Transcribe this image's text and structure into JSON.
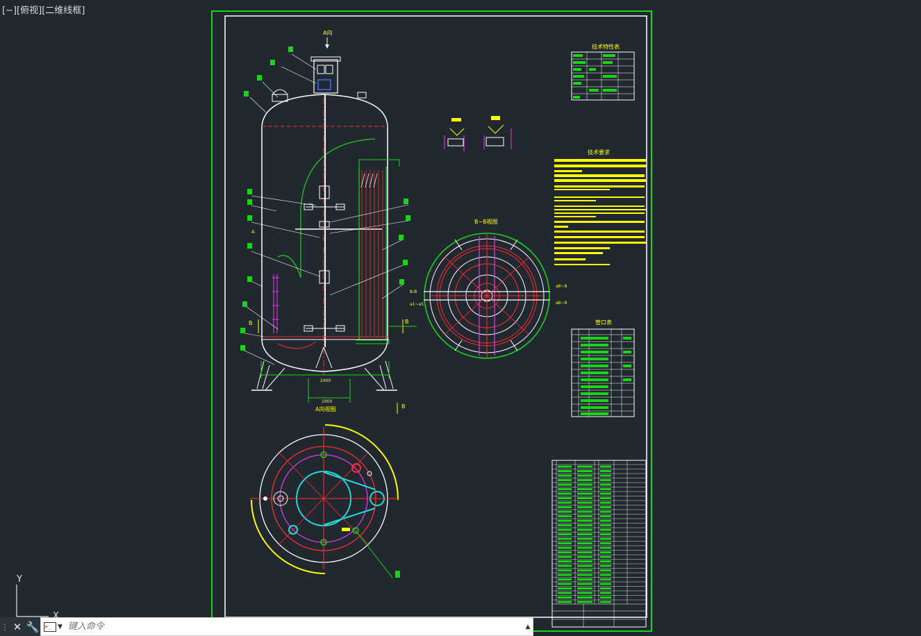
{
  "viewport": {
    "control": "[−]",
    "view": "[俯视]",
    "style": "[二维线框]"
  },
  "ucs": {
    "y_label": "Y",
    "x_label": "X"
  },
  "drawing": {
    "top_arrow_label": "A向",
    "b_view_title": "B−B视图",
    "a_view_title": "A向视图",
    "tech_char_title": "技术特性表",
    "tech_req_title": "技术要求",
    "nozzle_table_title": "管口表",
    "dim_bottom": "2400",
    "dim_base": "1900",
    "section_mark": "B",
    "left_mark": "A",
    "b_left_top": "B-B",
    "b_left_bottom": "a1~a5",
    "b_right_top": "a6~8",
    "b_right_bottom": "a6~8"
  },
  "command": {
    "close_label": "✕",
    "customize_label": "🔧",
    "placeholder": "键入命令"
  },
  "colors": {
    "frame_green": "#19d419",
    "frame_white": "#ffffff",
    "red": "#ff2d2d",
    "yellow": "#ffff00",
    "magenta": "#e838e8",
    "cyan": "#1fdfdf",
    "bg": "#212830"
  }
}
